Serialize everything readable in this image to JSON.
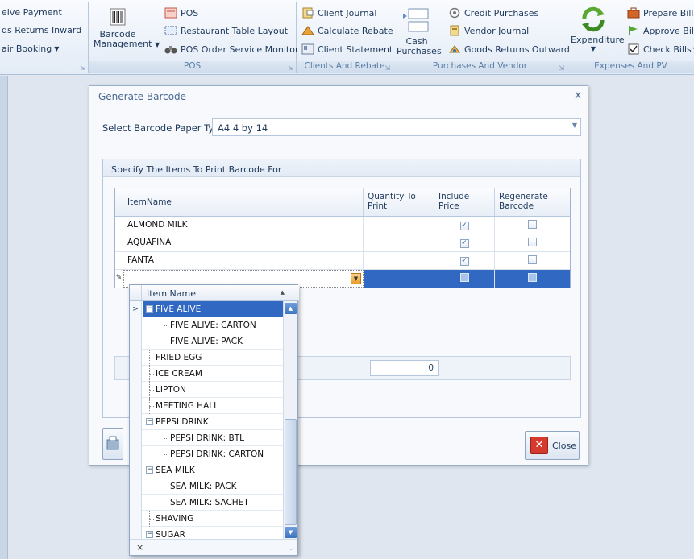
{
  "ribbon": {
    "group1": {
      "items": [
        "eive Payment",
        "ds Returns Inward",
        "air Booking"
      ]
    },
    "group2": {
      "big_button": {
        "line1": "Barcode",
        "line2": "Management"
      },
      "items": [
        "POS",
        "Restaurant Table Layout",
        "POS Order Service Monitor"
      ],
      "caption": "POS"
    },
    "group3": {
      "items": [
        "Client Journal",
        "Calculate Rebate",
        "Client Statement"
      ],
      "caption": "Clients And Rebate"
    },
    "group4": {
      "big_button": {
        "line1": "Cash",
        "line2": "Purchases"
      },
      "items": [
        "Credit Purchases",
        "Vendor Journal",
        "Goods Returns Outward"
      ],
      "caption": "Purchases And Vendor"
    },
    "group5": {
      "big_button": {
        "line1": "Expenditure"
      },
      "items": [
        "Prepare Bills",
        "Approve Bill",
        "Check Bills"
      ],
      "caption": "Expenses And PV"
    }
  },
  "dialog": {
    "title": "Generate Barcode",
    "close_glyph": "x",
    "paper_label": "Select Barcode Paper Type",
    "paper_value": "A4 4 by 14",
    "group_caption": "Specify The Items To Print Barcode For",
    "columns": [
      "ItemName",
      "Quantity To Print",
      "Include Price",
      "Regenerate Barcode"
    ],
    "rows": [
      {
        "name": "ALMOND MILK",
        "qty": "",
        "include_price": true,
        "regenerate": false
      },
      {
        "name": "AQUAFINA",
        "qty": "",
        "include_price": true,
        "regenerate": false
      },
      {
        "name": "FANTA",
        "qty": "",
        "include_price": true,
        "regenerate": false
      }
    ],
    "total_qty": "0",
    "close_button": "Close"
  },
  "dropdown": {
    "header": "Item Name",
    "items": [
      {
        "label": "FIVE ALIVE",
        "level": 0,
        "expander": "−"
      },
      {
        "label": "FIVE ALIVE: CARTON",
        "level": 1
      },
      {
        "label": "FIVE ALIVE: PACK",
        "level": 1
      },
      {
        "label": "FRIED EGG",
        "level": 0
      },
      {
        "label": "ICE CREAM",
        "level": 0
      },
      {
        "label": "LIPTON",
        "level": 0
      },
      {
        "label": "MEETING HALL",
        "level": 0
      },
      {
        "label": "PEPSI DRINK",
        "level": 0,
        "expander": "−"
      },
      {
        "label": "PEPSI DRINK: BTL",
        "level": 1
      },
      {
        "label": "PEPSI DRINK: CARTON",
        "level": 1
      },
      {
        "label": "SEA MILK",
        "level": 0,
        "expander": "−"
      },
      {
        "label": "SEA MILK: PACK",
        "level": 1
      },
      {
        "label": "SEA MILK: SACHET",
        "level": 1
      },
      {
        "label": "SHAVING",
        "level": 0
      },
      {
        "label": "SUGAR",
        "level": 0,
        "expander": "−"
      }
    ],
    "clear_glyph": "×"
  },
  "colors": {
    "selection": "#3168c1",
    "close_red": "#d43b2e"
  }
}
